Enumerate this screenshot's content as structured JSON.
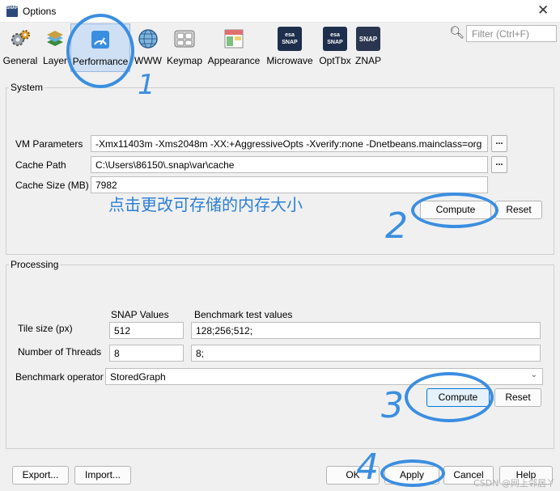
{
  "window": {
    "title": "Options",
    "app_icon_text": "SNAP",
    "close_glyph": "✕"
  },
  "toolbar": {
    "items": [
      {
        "label": "General",
        "icon": "gears-icon"
      },
      {
        "label": "Layer",
        "icon": "layers-icon"
      },
      {
        "label": "Performance",
        "icon": "performance-gauge-icon",
        "selected": true
      },
      {
        "label": "WWW",
        "icon": "globe-icon"
      },
      {
        "label": "Keymap",
        "icon": "keyboard-icon"
      },
      {
        "label": "Appearance",
        "icon": "appearance-icon"
      },
      {
        "label": "Microwave",
        "icon": "esa-microwave-icon"
      },
      {
        "label": "OptTbx",
        "icon": "esa-optical-icon"
      },
      {
        "label": "ZNAP",
        "icon": "snap-icon"
      }
    ],
    "esa_badge": "esa",
    "microwave_badge": "SNAP",
    "opttbx_badge": "SNAP",
    "znap_badge": "SNAP"
  },
  "filter": {
    "placeholder": "Filter (Ctrl+F)",
    "value": ""
  },
  "system": {
    "title": "System",
    "vm_label": "VM Parameters",
    "vm_value": "-Xmx11403m -Xms2048m -XX:+AggressiveOpts -Xverify:none -Dnetbeans.mainclass=org",
    "cache_path_label": "Cache Path",
    "cache_path_value": "C:\\Users\\86150\\.snap\\var\\cache",
    "cache_size_label": "Cache Size (MB)",
    "cache_size_value": "7982",
    "dots": "...",
    "compute_label": "Compute",
    "reset_label": "Reset"
  },
  "processing": {
    "title": "Processing",
    "snap_values_header": "SNAP Values",
    "benchmark_header": "Benchmark test values",
    "tile_size_label": "Tile size (px)",
    "tile_size_value": "512",
    "tile_size_bench": "128;256;512;",
    "threads_label": "Number of Threads",
    "threads_value": "8",
    "threads_bench": "8;",
    "operator_label": "Benchmark operator",
    "operator_value": "StoredGraph",
    "compute_label": "Compute",
    "reset_label": "Reset"
  },
  "footer": {
    "export_label": "Export...",
    "import_label": "Import...",
    "ok_label": "OK",
    "apply_label": "Apply",
    "cancel_label": "Cancel",
    "help_label": "Help"
  },
  "annotations": {
    "note": "点击更改可存储的内存大小",
    "n1": "1",
    "n2": "2",
    "n3": "3",
    "n4": "4",
    "color": "#3a8ee0"
  },
  "watermark": "CSDN @网上邻居丫"
}
